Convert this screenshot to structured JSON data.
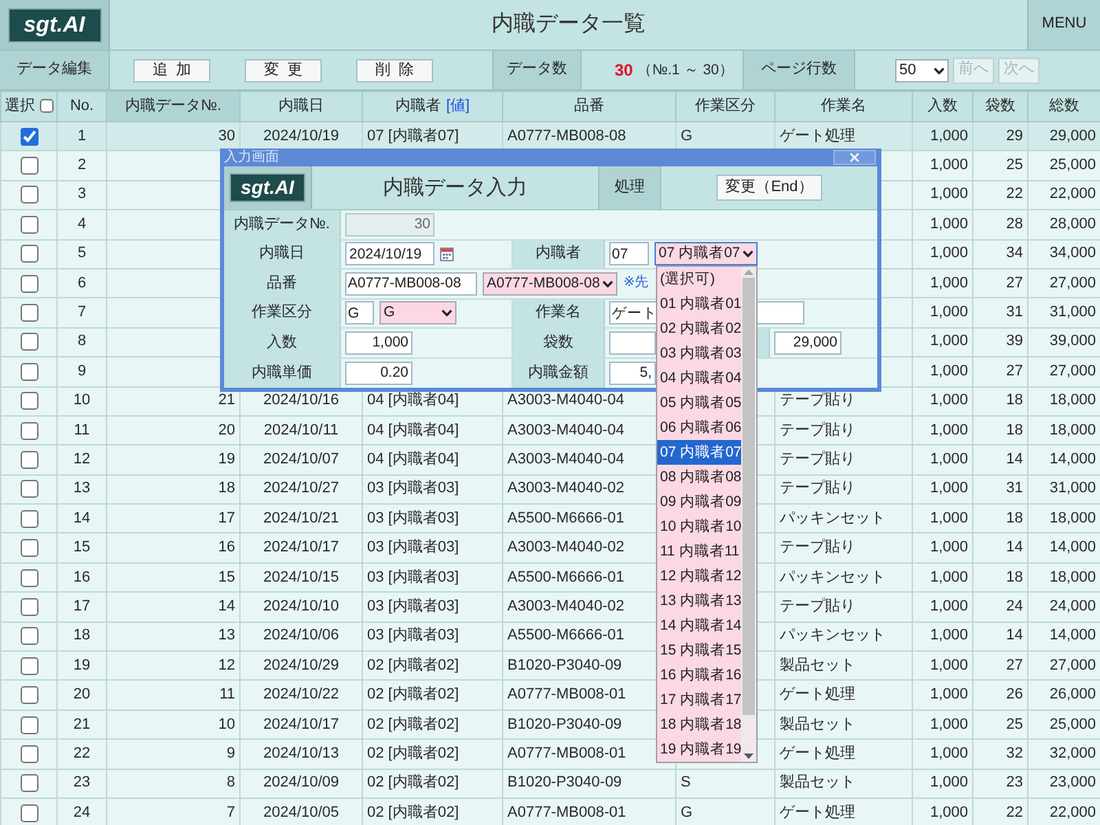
{
  "header": {
    "logo": "sgt.AI",
    "title": "内職データ一覧",
    "menu": "MENU"
  },
  "toolbar": {
    "edit_label": "データ編集",
    "buttons": [
      {
        "label": "追加"
      },
      {
        "label": "変更"
      },
      {
        "label": "削除"
      }
    ],
    "count_label": "データ数",
    "count": "30",
    "range": "（№.1 ～ 30）",
    "page_rows_label": "ページ行数",
    "page_rows": "50",
    "nav_buttons": [
      {
        "label": "前へ",
        "disabled": true
      },
      {
        "label": "次へ",
        "disabled": true
      }
    ]
  },
  "table": {
    "columns": [
      {
        "label": "選択",
        "kind": "checkbox",
        "checked": false,
        "sorted": false
      },
      {
        "label": "No.",
        "kind": "plain",
        "sorted": false
      },
      {
        "label": "内職データ№.",
        "kind": "plain",
        "sorted": true
      },
      {
        "label": "内職日",
        "kind": "plain",
        "sorted": false
      },
      {
        "label": "内職者",
        "kind": "link",
        "link": "[値]",
        "sorted": false
      },
      {
        "label": "品番",
        "kind": "plain",
        "sorted": false
      },
      {
        "label": "作業区分",
        "kind": "plain",
        "sorted": false
      },
      {
        "label": "作業名",
        "kind": "plain",
        "sorted": false
      },
      {
        "label": "入数",
        "kind": "plain",
        "sorted": false
      },
      {
        "label": "袋数",
        "kind": "plain",
        "sorted": false
      },
      {
        "label": "総数",
        "kind": "plain",
        "sorted": false
      }
    ],
    "rows": [
      {
        "no": "1",
        "checked": true,
        "data_no": "30",
        "date": "2024/10/19",
        "worker": "07 [内職者07]",
        "part": "A0777-MB008-08",
        "work_type": "G",
        "work_name": "ゲート処理",
        "qty": "1,000",
        "bags": "29",
        "total": "29,000"
      },
      {
        "no": "2",
        "checked": false,
        "qty": "1,000",
        "bags": "25",
        "total": "25,000"
      },
      {
        "no": "3",
        "checked": false,
        "qty": "1,000",
        "bags": "22",
        "total": "22,000"
      },
      {
        "no": "4",
        "checked": false,
        "qty": "1,000",
        "bags": "28",
        "total": "28,000"
      },
      {
        "no": "5",
        "checked": false,
        "qty": "1,000",
        "bags": "34",
        "total": "34,000"
      },
      {
        "no": "6",
        "checked": false,
        "qty": "1,000",
        "bags": "27",
        "total": "27,000"
      },
      {
        "no": "7",
        "checked": false,
        "qty": "1,000",
        "bags": "31",
        "total": "31,000"
      },
      {
        "no": "8",
        "checked": false,
        "qty": "1,000",
        "bags": "39",
        "total": "39,000"
      },
      {
        "no": "9",
        "checked": false,
        "qty": "1,000",
        "bags": "27",
        "total": "27,000"
      },
      {
        "no": "10",
        "checked": false,
        "data_no": "21",
        "date": "2024/10/16",
        "worker": "04 [内職者04]",
        "part": "A3003-M4040-04",
        "work_name": "テープ貼り",
        "qty": "1,000",
        "bags": "18",
        "total": "18,000"
      },
      {
        "no": "11",
        "checked": false,
        "data_no": "20",
        "date": "2024/10/11",
        "worker": "04 [内職者04]",
        "part": "A3003-M4040-04",
        "work_name": "テープ貼り",
        "qty": "1,000",
        "bags": "18",
        "total": "18,000"
      },
      {
        "no": "12",
        "checked": false,
        "data_no": "19",
        "date": "2024/10/07",
        "worker": "04 [内職者04]",
        "part": "A3003-M4040-04",
        "work_name": "テープ貼り",
        "qty": "1,000",
        "bags": "14",
        "total": "14,000"
      },
      {
        "no": "13",
        "checked": false,
        "data_no": "18",
        "date": "2024/10/27",
        "worker": "03 [内職者03]",
        "part": "A3003-M4040-02",
        "work_name": "テープ貼り",
        "qty": "1,000",
        "bags": "31",
        "total": "31,000"
      },
      {
        "no": "14",
        "checked": false,
        "data_no": "17",
        "date": "2024/10/21",
        "worker": "03 [内職者03]",
        "part": "A5500-M6666-01",
        "work_name": "パッキンセット",
        "qty": "1,000",
        "bags": "18",
        "total": "18,000"
      },
      {
        "no": "15",
        "checked": false,
        "data_no": "16",
        "date": "2024/10/17",
        "worker": "03 [内職者03]",
        "part": "A3003-M4040-02",
        "work_name": "テープ貼り",
        "qty": "1,000",
        "bags": "14",
        "total": "14,000"
      },
      {
        "no": "16",
        "checked": false,
        "data_no": "15",
        "date": "2024/10/15",
        "worker": "03 [内職者03]",
        "part": "A5500-M6666-01",
        "work_name": "パッキンセット",
        "qty": "1,000",
        "bags": "18",
        "total": "18,000"
      },
      {
        "no": "17",
        "checked": false,
        "data_no": "14",
        "date": "2024/10/10",
        "worker": "03 [内職者03]",
        "part": "A3003-M4040-02",
        "work_name": "テープ貼り",
        "qty": "1,000",
        "bags": "24",
        "total": "24,000"
      },
      {
        "no": "18",
        "checked": false,
        "data_no": "13",
        "date": "2024/10/06",
        "worker": "03 [内職者03]",
        "part": "A5500-M6666-01",
        "work_name": "パッキンセット",
        "qty": "1,000",
        "bags": "14",
        "total": "14,000"
      },
      {
        "no": "19",
        "checked": false,
        "data_no": "12",
        "date": "2024/10/29",
        "worker": "02 [内職者02]",
        "part": "B1020-P3040-09",
        "work_name": "製品セット",
        "qty": "1,000",
        "bags": "27",
        "total": "27,000"
      },
      {
        "no": "20",
        "checked": false,
        "data_no": "11",
        "date": "2024/10/22",
        "worker": "02 [内職者02]",
        "part": "A0777-MB008-01",
        "work_name": "ゲート処理",
        "qty": "1,000",
        "bags": "26",
        "total": "26,000"
      },
      {
        "no": "21",
        "checked": false,
        "data_no": "10",
        "date": "2024/10/17",
        "worker": "02 [内職者02]",
        "part": "B1020-P3040-09",
        "work_name": "製品セット",
        "qty": "1,000",
        "bags": "25",
        "total": "25,000"
      },
      {
        "no": "22",
        "checked": false,
        "data_no": "9",
        "date": "2024/10/13",
        "worker": "02 [内職者02]",
        "part": "A0777-MB008-01",
        "work_name": "ゲート処理",
        "qty": "1,000",
        "bags": "32",
        "total": "32,000"
      },
      {
        "no": "23",
        "checked": false,
        "data_no": "8",
        "date": "2024/10/09",
        "worker": "02 [内職者02]",
        "part": "B1020-P3040-09",
        "work_type": "S",
        "work_name": "製品セット",
        "qty": "1,000",
        "bags": "23",
        "total": "23,000"
      },
      {
        "no": "24",
        "checked": false,
        "data_no": "7",
        "date": "2024/10/05",
        "worker": "02 [内職者02]",
        "part": "A0777-MB008-01",
        "work_type": "G",
        "work_name": "ゲート処理",
        "qty": "1,000",
        "bags": "22",
        "total": "22,000"
      }
    ]
  },
  "dialog": {
    "title": "入力画面",
    "logo": "sgt.AI",
    "heading": "内職データ入力",
    "process_label": "処理",
    "process_button": "変更（End）",
    "rows": [
      {
        "fields": [
          {
            "label": "内職データ№.",
            "controls": [
              {
                "kind": "readonly",
                "value": "30"
              }
            ]
          }
        ]
      },
      {
        "fields": [
          {
            "label": "内職日",
            "controls": [
              {
                "kind": "date",
                "value": "2024/10/19"
              }
            ]
          },
          {
            "label": "内職者",
            "controls": [
              {
                "kind": "text",
                "value": "07"
              },
              {
                "kind": "select",
                "value": "07 内職者07",
                "expanded": true,
                "options": [
                  {
                    "label": "(選択可)",
                    "selected": false
                  },
                  {
                    "label": "01 内職者01",
                    "selected": false
                  },
                  {
                    "label": "02 内職者02",
                    "selected": false
                  },
                  {
                    "label": "03 内職者03",
                    "selected": false
                  },
                  {
                    "label": "04 内職者04",
                    "selected": false
                  },
                  {
                    "label": "05 内職者05",
                    "selected": false
                  },
                  {
                    "label": "06 内職者06",
                    "selected": false
                  },
                  {
                    "label": "07 内職者07",
                    "selected": true
                  },
                  {
                    "label": "08 内職者08",
                    "selected": false
                  },
                  {
                    "label": "09 内職者09",
                    "selected": false
                  },
                  {
                    "label": "10 内職者10",
                    "selected": false
                  },
                  {
                    "label": "11 内職者11",
                    "selected": false
                  },
                  {
                    "label": "12 内職者12",
                    "selected": false
                  },
                  {
                    "label": "13 内職者13",
                    "selected": false
                  },
                  {
                    "label": "14 内職者14",
                    "selected": false
                  },
                  {
                    "label": "15 内職者15",
                    "selected": false
                  },
                  {
                    "label": "16 内職者16",
                    "selected": false
                  },
                  {
                    "label": "17 内職者17",
                    "selected": false
                  },
                  {
                    "label": "18 内職者18",
                    "selected": false
                  },
                  {
                    "label": "19 内職者19",
                    "selected": false
                  }
                ]
              }
            ]
          }
        ]
      },
      {
        "fields": [
          {
            "label": "品番",
            "controls": [
              {
                "kind": "text",
                "value": "A0777-MB008-08"
              },
              {
                "kind": "select",
                "value": "A0777-MB008-08",
                "expanded": false
              },
              {
                "kind": "note",
                "text": "※先"
              }
            ]
          }
        ]
      },
      {
        "fields": [
          {
            "label": "作業区分",
            "controls": [
              {
                "kind": "text",
                "value": "G"
              },
              {
                "kind": "select",
                "value": "G",
                "expanded": false
              }
            ]
          },
          {
            "label": "作業名",
            "controls": [
              {
                "kind": "text",
                "value": "ゲート"
              }
            ]
          }
        ]
      },
      {
        "fields": [
          {
            "label": "入数",
            "controls": [
              {
                "kind": "number",
                "value": "1,000"
              }
            ]
          },
          {
            "label": "袋数",
            "controls": [
              {
                "kind": "number"
              }
            ]
          },
          {
            "controls": [
              {
                "kind": "number",
                "value": "29,000"
              }
            ]
          }
        ]
      },
      {
        "fields": [
          {
            "label": "内職単価",
            "controls": [
              {
                "kind": "number",
                "value": "0.20"
              }
            ]
          },
          {
            "label": "内職金額",
            "controls": [
              {
                "kind": "number",
                "value": "5,"
              }
            ]
          }
        ]
      }
    ]
  }
}
